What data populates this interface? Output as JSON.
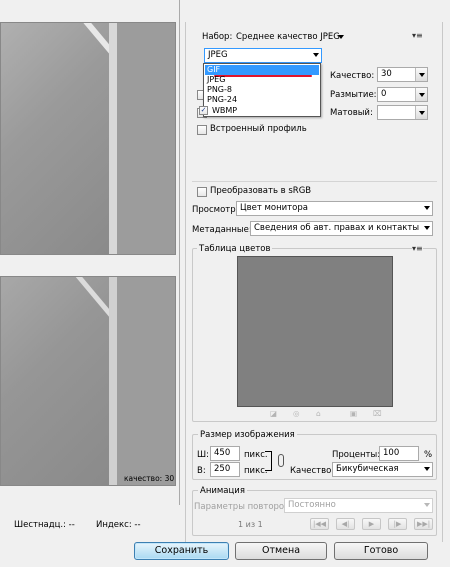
{
  "preset": {
    "label": "Набор:",
    "value": "Среднее качество JPEG"
  },
  "format": {
    "value": "JPEG",
    "options": [
      "GIF",
      "JPEG",
      "PNG-8",
      "PNG-24",
      "WBMP"
    ]
  },
  "quality": {
    "label": "Качество:",
    "value": "30"
  },
  "blur": {
    "label": "Размытие:",
    "value": "0"
  },
  "matte": {
    "label": "Матовый:",
    "value": ""
  },
  "embedded_profile": {
    "label": "Встроенный профиль",
    "checked": false
  },
  "convert_srgb": {
    "label": "Преобразовать в sRGB",
    "checked": false
  },
  "preview": {
    "label": "Просмотр:",
    "value": "Цвет монитора"
  },
  "metadata": {
    "label": "Метаданные:",
    "value": "Сведения об авт. правах и контакты"
  },
  "color_table": {
    "title": "Таблица цветов"
  },
  "image_size": {
    "title": "Размер изображения",
    "width_label": "Ш:",
    "width_value": "450",
    "width_unit": "пикс.",
    "height_label": "В:",
    "height_value": "250",
    "height_unit": "пикс.",
    "percent_label": "Проценты:",
    "percent_value": "100",
    "percent_unit": "%",
    "quality_label": "Качество:",
    "quality_value": "Бикубическая"
  },
  "animation": {
    "title": "Анимация",
    "repeat_label": "Параметры повторов:",
    "repeat_value": "Постоянно",
    "frame_counter": "1 из 1"
  },
  "preview_info": {
    "quality_text": "качество: 30"
  },
  "status": {
    "hex": "Шестнадц.: --",
    "index": "Индекс: --"
  },
  "buttons": {
    "save": "Сохранить",
    "cancel": "Отмена",
    "done": "Готово"
  },
  "colors": {
    "accent": "#3399ff",
    "highlight_underline": "#e0142d"
  },
  "icons": [
    "panel-menu-icon",
    "color-table-icons",
    "animation-nav-icons",
    "dropdown-arrow-icon"
  ]
}
